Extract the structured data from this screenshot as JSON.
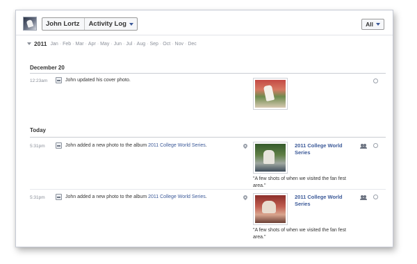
{
  "header": {
    "user_name": "John Lortz",
    "section_label": "Activity Log",
    "filter_label": "All"
  },
  "timeline": {
    "year": "2011",
    "months": [
      "Jan",
      "Feb",
      "Mar",
      "Apr",
      "May",
      "Jun",
      "Jul",
      "Aug",
      "Sep",
      "Oct",
      "Nov",
      "Dec"
    ]
  },
  "sections": [
    {
      "heading": "December 20",
      "items": [
        {
          "time": "12:23am",
          "text": "John updated his cover photo.",
          "icon": "cover-photo-icon"
        }
      ]
    },
    {
      "heading": "Today",
      "items": [
        {
          "time": "5:31pm",
          "text_prefix": "John added a new photo to the album ",
          "album_link": "2011 College World Series",
          "text_suffix": ".",
          "album_title": "2011 College World Series",
          "caption": "\"A few shots of when we visited the fan fest area.\"",
          "icon": "add-photo-icon"
        },
        {
          "time": "5:31pm",
          "text_prefix": "John added a new photo to the album ",
          "album_link": "2011 College World Series",
          "text_suffix": ".",
          "album_title": "2011 College World Series",
          "caption": "\"A few shots of when we visited the fan fest area.\"",
          "icon": "add-photo-icon"
        }
      ]
    }
  ],
  "colors": {
    "link": "#3b5998",
    "muted": "#8a8f99"
  }
}
